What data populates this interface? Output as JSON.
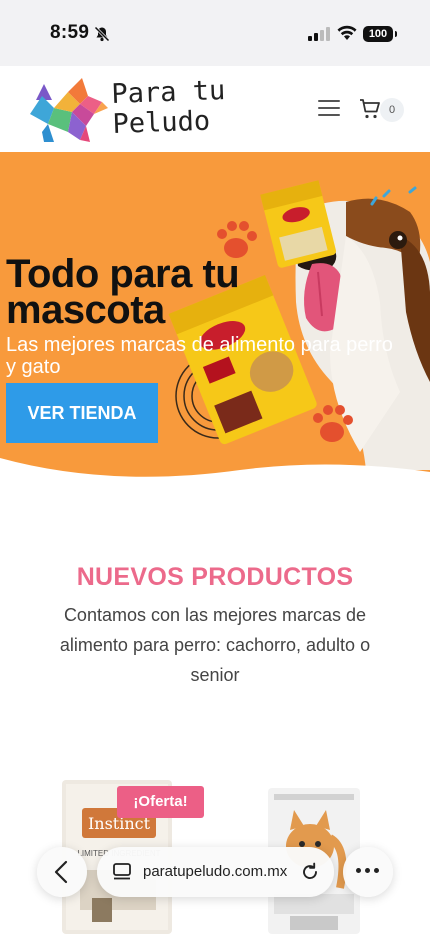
{
  "status_bar": {
    "time": "8:59",
    "battery": "100"
  },
  "header": {
    "logo_line1": "Para tu",
    "logo_line2": "Peludo",
    "cart_count": "0"
  },
  "hero": {
    "title_line1": "Todo para tu",
    "title_line2": "mascota",
    "subtitle": "Las mejores marcas de alimento para perro y gato",
    "button_label": "VER TIENDA"
  },
  "section": {
    "title": "NUEVOS PRODUCTOS",
    "description": "Contamos con las mejores marcas de alimento para perro: cachorro, adulto o senior"
  },
  "products": {
    "sale_badge": "¡Oferta!",
    "product_a_brand": "Instinct",
    "product_a_sub": "LIMITED INGREDIENT"
  },
  "browser": {
    "url": "paratupeludo.com.mx"
  },
  "colors": {
    "hero_orange": "#f89a3c",
    "accent_pink": "#ec6a8b",
    "button_blue": "#2e9be8",
    "badge_pink": "#ec5f86"
  },
  "icons": [
    "bell-slash-icon",
    "signal-icon",
    "wifi-icon",
    "battery-icon",
    "menu-icon",
    "cart-icon",
    "back-icon",
    "tabs-icon",
    "reload-icon",
    "more-icon",
    "paw-icon"
  ]
}
